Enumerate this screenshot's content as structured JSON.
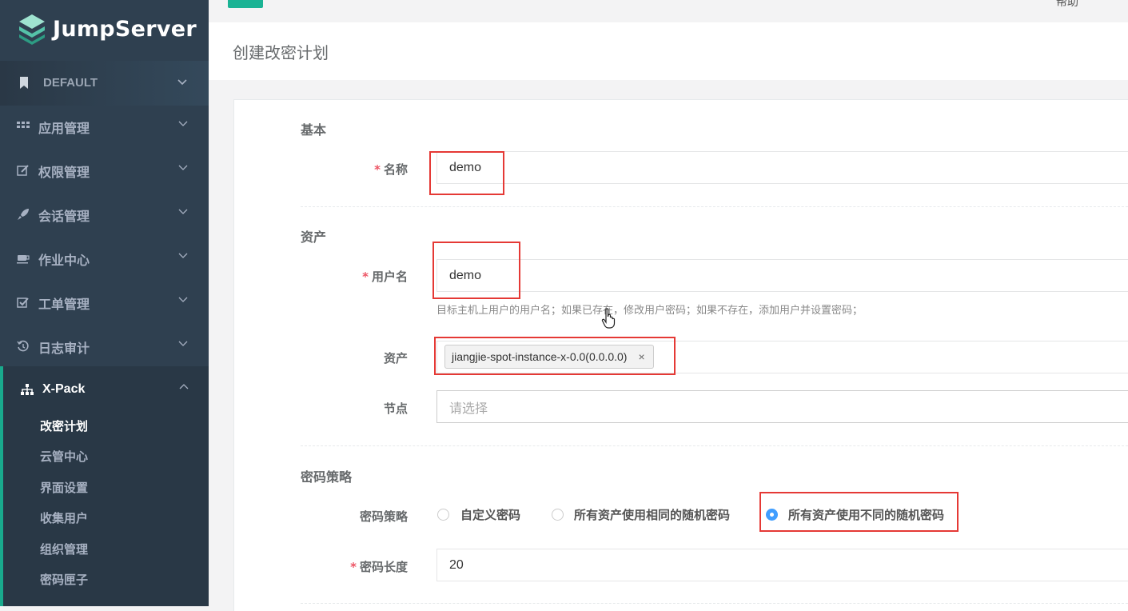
{
  "app": {
    "name": "JumpServer"
  },
  "topbar": {
    "help": "帮助"
  },
  "org": {
    "label": "DEFAULT"
  },
  "sidebar": {
    "items": [
      {
        "label": "应用管理",
        "icon": "grid-icon"
      },
      {
        "label": "权限管理",
        "icon": "edit-icon"
      },
      {
        "label": "会话管理",
        "icon": "rocket-icon"
      },
      {
        "label": "作业中心",
        "icon": "coffee-icon"
      },
      {
        "label": "工单管理",
        "icon": "check-square-icon"
      },
      {
        "label": "日志审计",
        "icon": "history-icon"
      }
    ],
    "xpack": {
      "label": "X-Pack",
      "children": [
        "改密计划",
        "云管中心",
        "界面设置",
        "收集用户",
        "组织管理",
        "密码匣子"
      ]
    }
  },
  "page": {
    "title": "创建改密计划"
  },
  "form": {
    "sections": {
      "basic": "基本",
      "assets": "资产",
      "policy": "密码策略"
    },
    "name": {
      "label": "名称",
      "value": "demo"
    },
    "username": {
      "label": "用户名",
      "value": "demo",
      "help": "目标主机上用户的用户名；如果已存在，修改用户密码；如果不存在，添加用户并设置密码；"
    },
    "assets": {
      "label": "资产",
      "tag": "jiangjie-spot-instance-x-0.0(0.0.0.0)",
      "remove": "×"
    },
    "nodes": {
      "label": "节点",
      "placeholder": "请选择"
    },
    "strategy": {
      "label": "密码策略",
      "options": [
        "自定义密码",
        "所有资产使用相同的随机密码",
        "所有资产使用不同的随机密码"
      ],
      "selected": 2
    },
    "length": {
      "label": "密码长度",
      "value": "20"
    },
    "required_mark": "*"
  }
}
